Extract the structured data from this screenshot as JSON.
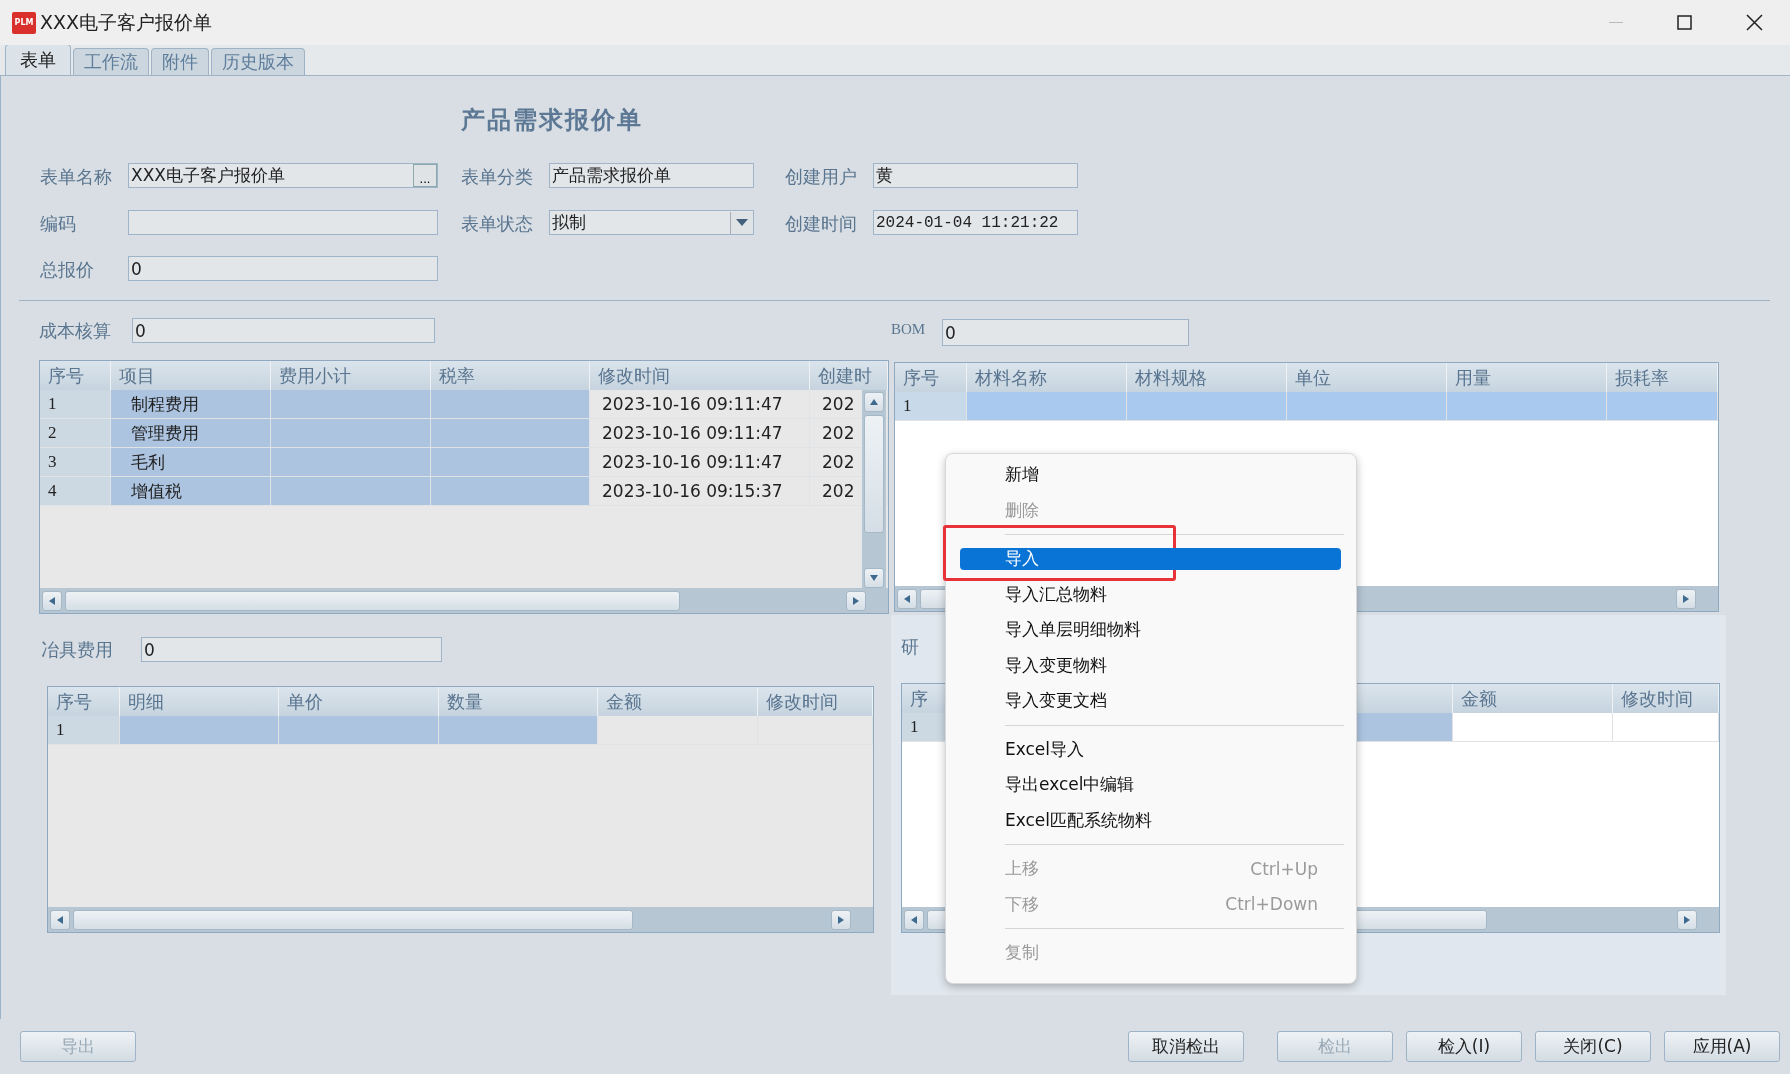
{
  "window": {
    "logo": "PLM",
    "title": "XXX电子客户报价单"
  },
  "tabs": [
    {
      "label": "表单",
      "selected": true
    },
    {
      "label": "工作流",
      "selected": false
    },
    {
      "label": "附件",
      "selected": false
    },
    {
      "label": "历史版本",
      "selected": false
    }
  ],
  "form": {
    "heading": "产品需求报价单",
    "fields": [
      {
        "label": "表单名称",
        "value": "XXX电子客户报价单",
        "kind": "browse",
        "button": "..."
      },
      {
        "label": "表单分类",
        "value": "产品需求报价单",
        "kind": "text"
      },
      {
        "label": "创建用户",
        "value": "黄",
        "kind": "text"
      },
      {
        "label": "编码",
        "kind": "text"
      },
      {
        "label": "表单状态",
        "value": "拟制",
        "kind": "select"
      },
      {
        "label": "创建时间",
        "value": "2024-01-04 11:21:22",
        "kind": "text"
      },
      {
        "label": "总报价",
        "value": "0",
        "kind": "text"
      }
    ]
  },
  "cost": {
    "label": "成本核算",
    "value": "0",
    "table": {
      "columns": [
        {
          "label": "序号",
          "kind": "index"
        },
        {
          "label": "项目",
          "kind": "editable"
        },
        {
          "label": "费用小计",
          "kind": "editable"
        },
        {
          "label": "税率",
          "kind": "editable"
        },
        {
          "label": "修改时间",
          "kind": "readonly"
        },
        {
          "label": "创建时",
          "kind": "readonly"
        }
      ],
      "rows": [
        {
          "selected": false,
          "cells": [
            "1",
            "制程费用",
            "",
            "",
            "2023-10-16 09:11:47",
            "202"
          ]
        },
        {
          "selected": false,
          "cells": [
            "2",
            "管理费用",
            "",
            "",
            "2023-10-16 09:11:47",
            "202"
          ]
        },
        {
          "selected": false,
          "cells": [
            "3",
            "毛利",
            "",
            "",
            "2023-10-16 09:11:47",
            "202"
          ]
        },
        {
          "selected": false,
          "cells": [
            "4",
            "增值税",
            "",
            "",
            "2023-10-16 09:15:37",
            "202"
          ]
        }
      ]
    }
  },
  "tooling": {
    "label": "冶具费用",
    "value": "0",
    "table": {
      "columns": [
        {
          "label": "序号",
          "kind": "index"
        },
        {
          "label": "明细",
          "kind": "editable"
        },
        {
          "label": "单价",
          "kind": "editable"
        },
        {
          "label": "数量",
          "kind": "editable"
        },
        {
          "label": "金额",
          "kind": "readonly"
        },
        {
          "label": "修改时间",
          "kind": "readonly"
        }
      ],
      "rows": [
        {
          "selected": false,
          "cells": [
            "1",
            "",
            "",
            "",
            "",
            ""
          ]
        }
      ]
    }
  },
  "bom": {
    "label": "BOM",
    "value": "0",
    "table": {
      "columns": [
        {
          "label": "序号",
          "kind": "index"
        },
        {
          "label": "材料名称",
          "kind": "readonly"
        },
        {
          "label": "材料规格",
          "kind": "readonly"
        },
        {
          "label": "单位",
          "kind": "readonly"
        },
        {
          "label": "用量",
          "kind": "readonly"
        },
        {
          "label": "损耗率",
          "kind": "readonly"
        }
      ],
      "rows": [
        {
          "selected": true,
          "cells": [
            "1",
            "",
            "",
            "",
            "",
            ""
          ]
        }
      ]
    }
  },
  "rd": {
    "label": "研",
    "table": {
      "columns": [
        {
          "label": "序",
          "kind": "index"
        },
        {
          "kind": "editable"
        },
        {
          "label": "金额",
          "kind": "readonly"
        },
        {
          "label": "修改时间",
          "kind": "readonly"
        }
      ],
      "rows": [
        {
          "selected": false,
          "cells": [
            "1",
            "",
            "",
            ""
          ]
        }
      ]
    }
  },
  "context_menu": {
    "items": [
      {
        "kind": "item",
        "label": "新增",
        "disabled": false,
        "selected": false,
        "annotated": false
      },
      {
        "kind": "item",
        "label": "删除",
        "disabled": true,
        "selected": false,
        "annotated": false
      },
      {
        "kind": "separator"
      },
      {
        "kind": "item",
        "label": "导入",
        "disabled": false,
        "selected": true,
        "annotated": true
      },
      {
        "kind": "item",
        "label": "导入汇总物料",
        "disabled": false,
        "selected": false,
        "annotated": false
      },
      {
        "kind": "item",
        "label": "导入单层明细物料",
        "disabled": false,
        "selected": false,
        "annotated": false
      },
      {
        "kind": "item",
        "label": "导入变更物料",
        "disabled": false,
        "selected": false,
        "annotated": false
      },
      {
        "kind": "item",
        "label": "导入变更文档",
        "disabled": false,
        "selected": false,
        "annotated": false
      },
      {
        "kind": "separator"
      },
      {
        "kind": "item",
        "label": "Excel导入",
        "disabled": false,
        "selected": false,
        "annotated": false
      },
      {
        "kind": "item",
        "label": "导出excel中编辑",
        "disabled": false,
        "selected": false,
        "annotated": false
      },
      {
        "kind": "item",
        "label": "Excel匹配系统物料",
        "disabled": false,
        "selected": false,
        "annotated": false
      },
      {
        "kind": "separator"
      },
      {
        "kind": "item",
        "label": "上移",
        "shortcut": "Ctrl+Up",
        "disabled": true,
        "selected": false,
        "annotated": false
      },
      {
        "kind": "item",
        "label": "下移",
        "shortcut": "Ctrl+Down",
        "disabled": true,
        "selected": false,
        "annotated": false
      },
      {
        "kind": "separator"
      },
      {
        "kind": "item",
        "label": "复制",
        "disabled": true,
        "selected": false,
        "annotated": false
      }
    ]
  },
  "footer": {
    "left_buttons": [
      {
        "label": "导出",
        "disabled": true
      }
    ],
    "right_buttons": [
      {
        "label": "取消检出",
        "disabled": false
      },
      {
        "label": "检出",
        "disabled": true
      },
      {
        "label": "检入(I)",
        "disabled": false
      },
      {
        "label": "关闭(C)",
        "disabled": false
      },
      {
        "label": "应用(A)",
        "disabled": false
      }
    ]
  }
}
